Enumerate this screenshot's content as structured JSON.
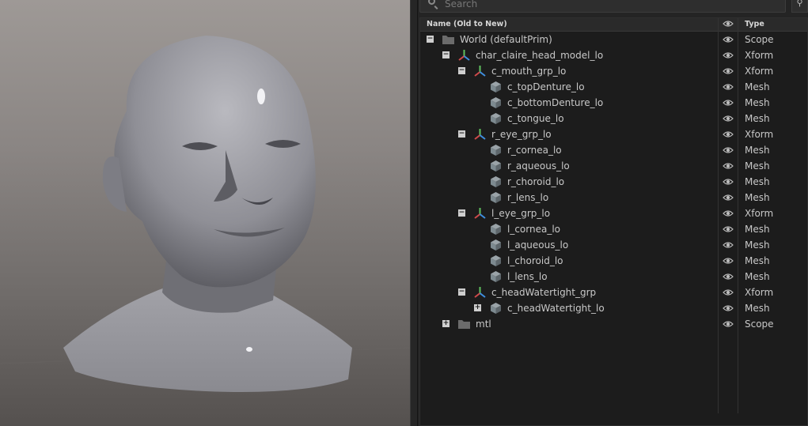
{
  "search": {
    "placeholder": "Search"
  },
  "outliner": {
    "columns": {
      "name": "Name (Old to New)",
      "type": "Type"
    },
    "rows": [
      {
        "label": "World (defaultPrim)",
        "type": "Scope",
        "depth": 0,
        "kind": "folder",
        "expand": "collapse"
      },
      {
        "label": "char_claire_head_model_lo",
        "type": "Xform",
        "depth": 1,
        "kind": "xform",
        "expand": "collapse"
      },
      {
        "label": "c_mouth_grp_lo",
        "type": "Xform",
        "depth": 2,
        "kind": "xform",
        "expand": "collapse"
      },
      {
        "label": "c_topDenture_lo",
        "type": "Mesh",
        "depth": 3,
        "kind": "mesh",
        "expand": "none"
      },
      {
        "label": "c_bottomDenture_lo",
        "type": "Mesh",
        "depth": 3,
        "kind": "mesh",
        "expand": "none"
      },
      {
        "label": "c_tongue_lo",
        "type": "Mesh",
        "depth": 3,
        "kind": "mesh",
        "expand": "none"
      },
      {
        "label": "r_eye_grp_lo",
        "type": "Xform",
        "depth": 2,
        "kind": "xform",
        "expand": "collapse"
      },
      {
        "label": "r_cornea_lo",
        "type": "Mesh",
        "depth": 3,
        "kind": "mesh",
        "expand": "none"
      },
      {
        "label": "r_aqueous_lo",
        "type": "Mesh",
        "depth": 3,
        "kind": "mesh",
        "expand": "none"
      },
      {
        "label": "r_choroid_lo",
        "type": "Mesh",
        "depth": 3,
        "kind": "mesh",
        "expand": "none"
      },
      {
        "label": "r_lens_lo",
        "type": "Mesh",
        "depth": 3,
        "kind": "mesh",
        "expand": "none"
      },
      {
        "label": "l_eye_grp_lo",
        "type": "Xform",
        "depth": 2,
        "kind": "xform",
        "expand": "collapse"
      },
      {
        "label": "l_cornea_lo",
        "type": "Mesh",
        "depth": 3,
        "kind": "mesh",
        "expand": "none"
      },
      {
        "label": "l_aqueous_lo",
        "type": "Mesh",
        "depth": 3,
        "kind": "mesh",
        "expand": "none"
      },
      {
        "label": "l_choroid_lo",
        "type": "Mesh",
        "depth": 3,
        "kind": "mesh",
        "expand": "none"
      },
      {
        "label": "l_lens_lo",
        "type": "Mesh",
        "depth": 3,
        "kind": "mesh",
        "expand": "none"
      },
      {
        "label": "c_headWatertight_grp",
        "type": "Xform",
        "depth": 2,
        "kind": "xform",
        "expand": "collapse"
      },
      {
        "label": "c_headWatertight_lo",
        "type": "Mesh",
        "depth": 3,
        "kind": "mesh",
        "expand": "expand"
      },
      {
        "label": "mtl",
        "type": "Scope",
        "depth": 1,
        "kind": "folder",
        "expand": "expand"
      }
    ]
  },
  "colors": {
    "folder": "#6b6b6b",
    "mesh": "#7d8a90",
    "xform_x": "#d04a4a",
    "xform_y": "#5fc25f",
    "xform_z": "#3f8fe0"
  }
}
